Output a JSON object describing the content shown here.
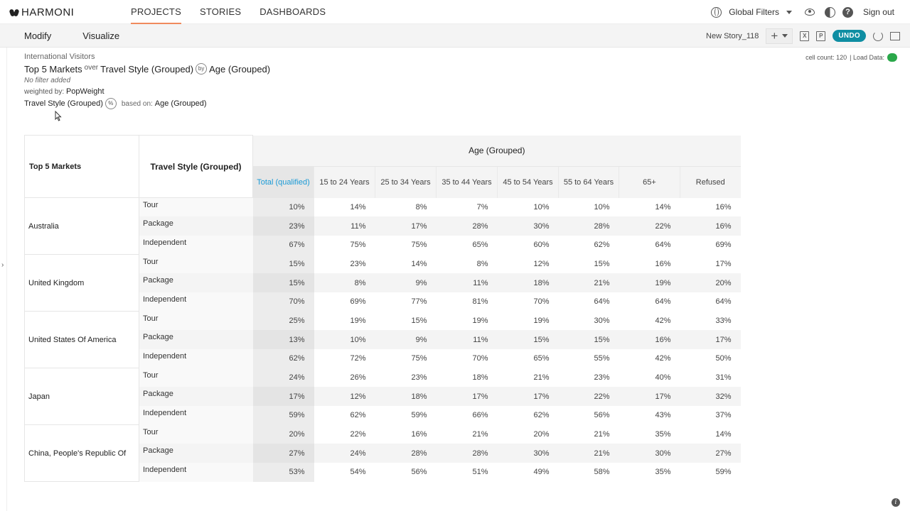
{
  "app": {
    "brand": "HARMONI"
  },
  "nav": {
    "tabs": [
      "PROJECTS",
      "STORIES",
      "DASHBOARDS"
    ],
    "global_filters": "Global Filters",
    "sign_out": "Sign out"
  },
  "toolbar": {
    "modify": "Modify",
    "visualize": "Visualize",
    "story_name": "New Story_118",
    "undo": "UNDO"
  },
  "header": {
    "source": "International Visitors",
    "row_var": "Top 5 Markets",
    "over": "over",
    "nested_var": "Travel Style (Grouped)",
    "by": "by",
    "col_var": "Age (Grouped)",
    "filter": "No filter added",
    "weighted_by_label": "weighted by:",
    "weight": "PopWeight",
    "pct_var": "Travel Style (Grouped)",
    "pct_icon": "%",
    "based_on_label": "based on:",
    "based_on": "Age (Grouped)",
    "cell_count_label": "cell count: 120",
    "load_data_label": "| Load Data:"
  },
  "table": {
    "row_header": "Top 5 Markets",
    "nested_header": "Travel Style (Grouped)",
    "col_group": "Age (Grouped)",
    "columns": [
      "Total (qualified)",
      "15 to 24 Years",
      "25 to 34 Years",
      "35 to 44 Years",
      "45 to 54 Years",
      "55 to 64 Years",
      "65+",
      "Refused"
    ],
    "rows": [
      {
        "market": "Australia",
        "styles": [
          {
            "style": "Tour",
            "values": [
              "10%",
              "14%",
              "8%",
              "7%",
              "10%",
              "10%",
              "14%",
              "16%"
            ]
          },
          {
            "style": "Package",
            "values": [
              "23%",
              "11%",
              "17%",
              "28%",
              "30%",
              "28%",
              "22%",
              "16%"
            ]
          },
          {
            "style": "Independent",
            "values": [
              "67%",
              "75%",
              "75%",
              "65%",
              "60%",
              "62%",
              "64%",
              "69%"
            ]
          }
        ]
      },
      {
        "market": "United Kingdom",
        "styles": [
          {
            "style": "Tour",
            "values": [
              "15%",
              "23%",
              "14%",
              "8%",
              "12%",
              "15%",
              "16%",
              "17%"
            ]
          },
          {
            "style": "Package",
            "values": [
              "15%",
              "8%",
              "9%",
              "11%",
              "18%",
              "21%",
              "19%",
              "20%"
            ]
          },
          {
            "style": "Independent",
            "values": [
              "70%",
              "69%",
              "77%",
              "81%",
              "70%",
              "64%",
              "64%",
              "64%"
            ]
          }
        ]
      },
      {
        "market": "United States Of America",
        "styles": [
          {
            "style": "Tour",
            "values": [
              "25%",
              "19%",
              "15%",
              "19%",
              "19%",
              "30%",
              "42%",
              "33%"
            ]
          },
          {
            "style": "Package",
            "values": [
              "13%",
              "10%",
              "9%",
              "11%",
              "15%",
              "15%",
              "16%",
              "17%"
            ]
          },
          {
            "style": "Independent",
            "values": [
              "62%",
              "72%",
              "75%",
              "70%",
              "65%",
              "55%",
              "42%",
              "50%"
            ]
          }
        ]
      },
      {
        "market": "Japan",
        "styles": [
          {
            "style": "Tour",
            "values": [
              "24%",
              "26%",
              "23%",
              "18%",
              "21%",
              "23%",
              "40%",
              "31%"
            ]
          },
          {
            "style": "Package",
            "values": [
              "17%",
              "12%",
              "18%",
              "17%",
              "17%",
              "22%",
              "17%",
              "32%"
            ]
          },
          {
            "style": "Independent",
            "values": [
              "59%",
              "62%",
              "59%",
              "66%",
              "62%",
              "56%",
              "43%",
              "37%"
            ]
          }
        ]
      },
      {
        "market": "China, People's Republic Of",
        "styles": [
          {
            "style": "Tour",
            "values": [
              "20%",
              "22%",
              "16%",
              "21%",
              "20%",
              "21%",
              "35%",
              "14%"
            ]
          },
          {
            "style": "Package",
            "values": [
              "27%",
              "24%",
              "28%",
              "28%",
              "30%",
              "21%",
              "30%",
              "27%"
            ]
          },
          {
            "style": "Independent",
            "values": [
              "53%",
              "54%",
              "56%",
              "51%",
              "49%",
              "58%",
              "35%",
              "59%"
            ]
          }
        ]
      }
    ]
  }
}
